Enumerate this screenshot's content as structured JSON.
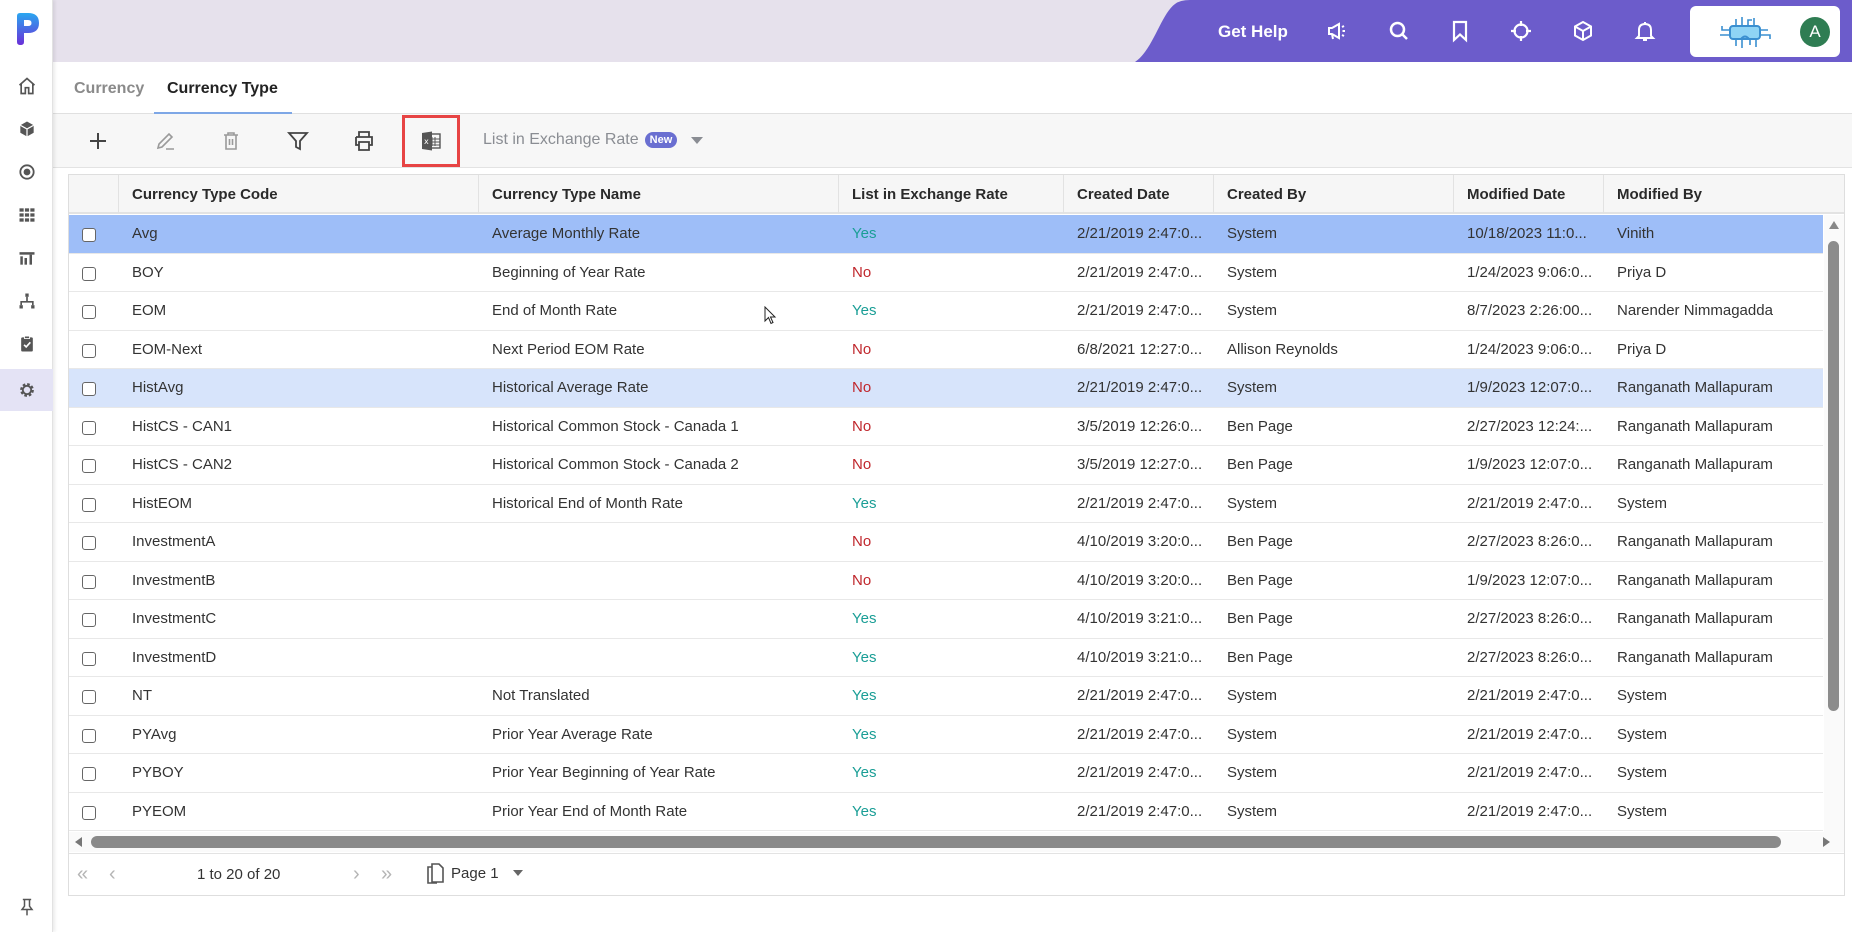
{
  "sidebar": {
    "logo": "P",
    "items": [
      {
        "name": "home",
        "icon": "home-icon"
      },
      {
        "name": "cube",
        "icon": "cube-icon"
      },
      {
        "name": "target",
        "icon": "target-icon"
      },
      {
        "name": "grid",
        "icon": "grid-icon"
      },
      {
        "name": "reports",
        "icon": "bar-chart-icon"
      },
      {
        "name": "hierarchy",
        "icon": "hierarchy-icon"
      },
      {
        "name": "tasks",
        "icon": "clipboard-check-icon"
      },
      {
        "name": "settings",
        "icon": "gear-icon",
        "active": true
      }
    ],
    "pin_icon": "pin-icon"
  },
  "header": {
    "get_help": "Get Help",
    "icons": [
      "megaphone-icon",
      "search-icon",
      "bookmark-icon",
      "crosshair-icon",
      "cube-icon",
      "bell-icon"
    ],
    "avatar_initial": "A",
    "brand_color": "#6c5ccb"
  },
  "tabs": [
    {
      "label": "Currency",
      "active": false
    },
    {
      "label": "Currency Type",
      "active": true
    }
  ],
  "toolbar": {
    "actions": [
      "add",
      "edit",
      "delete",
      "filter",
      "print",
      "export-excel"
    ],
    "list_filter_label": "List in Exchange Rate",
    "new_badge": "New"
  },
  "grid": {
    "columns": [
      "Currency Type Code",
      "Currency Type Name",
      "List in Exchange Rate",
      "Created Date",
      "Created By",
      "Modified Date",
      "Modified By"
    ],
    "rows": [
      {
        "code": "Avg",
        "name": "Average Monthly Rate",
        "list": "Yes",
        "created_date": "2/21/2019 2:47:0...",
        "created_by": "System",
        "modified_date": "10/18/2023 11:0...",
        "modified_by": "Vinith",
        "state": "selected"
      },
      {
        "code": "BOY",
        "name": "Beginning of Year Rate",
        "list": "No",
        "created_date": "2/21/2019 2:47:0...",
        "created_by": "System",
        "modified_date": "1/24/2023 9:06:0...",
        "modified_by": "Priya D",
        "state": ""
      },
      {
        "code": "EOM",
        "name": "End of Month Rate",
        "list": "Yes",
        "created_date": "2/21/2019 2:47:0...",
        "created_by": "System",
        "modified_date": "8/7/2023 2:26:00...",
        "modified_by": "Narender Nimmagadda",
        "state": ""
      },
      {
        "code": "EOM-Next",
        "name": "Next Period EOM Rate",
        "list": "No",
        "created_date": "6/8/2021 12:27:0...",
        "created_by": "Allison Reynolds",
        "modified_date": "1/24/2023 9:06:0...",
        "modified_by": "Priya D",
        "state": ""
      },
      {
        "code": "HistAvg",
        "name": "Historical Average Rate",
        "list": "No",
        "created_date": "2/21/2019 2:47:0...",
        "created_by": "System",
        "modified_date": "1/9/2023 12:07:0...",
        "modified_by": "Ranganath Mallapuram",
        "state": "hover"
      },
      {
        "code": "HistCS - CAN1",
        "name": "Historical Common Stock - Canada 1",
        "list": "No",
        "created_date": "3/5/2019 12:26:0...",
        "created_by": "Ben Page",
        "modified_date": "2/27/2023 12:24:...",
        "modified_by": "Ranganath Mallapuram",
        "state": ""
      },
      {
        "code": "HistCS - CAN2",
        "name": "Historical Common Stock - Canada 2",
        "list": "No",
        "created_date": "3/5/2019 12:27:0...",
        "created_by": "Ben Page",
        "modified_date": "1/9/2023 12:07:0...",
        "modified_by": "Ranganath Mallapuram",
        "state": ""
      },
      {
        "code": "HistEOM",
        "name": "Historical End of Month Rate",
        "list": "Yes",
        "created_date": "2/21/2019 2:47:0...",
        "created_by": "System",
        "modified_date": "2/21/2019 2:47:0...",
        "modified_by": "System",
        "state": ""
      },
      {
        "code": "InvestmentA",
        "name": "",
        "list": "No",
        "created_date": "4/10/2019 3:20:0...",
        "created_by": "Ben Page",
        "modified_date": "2/27/2023 8:26:0...",
        "modified_by": "Ranganath Mallapuram",
        "state": ""
      },
      {
        "code": "InvestmentB",
        "name": "",
        "list": "No",
        "created_date": "4/10/2019 3:20:0...",
        "created_by": "Ben Page",
        "modified_date": "1/9/2023 12:07:0...",
        "modified_by": "Ranganath Mallapuram",
        "state": ""
      },
      {
        "code": "InvestmentC",
        "name": "",
        "list": "Yes",
        "created_date": "4/10/2019 3:21:0...",
        "created_by": "Ben Page",
        "modified_date": "2/27/2023 8:26:0...",
        "modified_by": "Ranganath Mallapuram",
        "state": ""
      },
      {
        "code": "InvestmentD",
        "name": "",
        "list": "Yes",
        "created_date": "4/10/2019 3:21:0...",
        "created_by": "Ben Page",
        "modified_date": "2/27/2023 8:26:0...",
        "modified_by": "Ranganath Mallapuram",
        "state": ""
      },
      {
        "code": "NT",
        "name": "Not Translated",
        "list": "Yes",
        "created_date": "2/21/2019 2:47:0...",
        "created_by": "System",
        "modified_date": "2/21/2019 2:47:0...",
        "modified_by": "System",
        "state": ""
      },
      {
        "code": "PYAvg",
        "name": "Prior Year Average Rate",
        "list": "Yes",
        "created_date": "2/21/2019 2:47:0...",
        "created_by": "System",
        "modified_date": "2/21/2019 2:47:0...",
        "modified_by": "System",
        "state": ""
      },
      {
        "code": "PYBOY",
        "name": "Prior Year Beginning of Year Rate",
        "list": "Yes",
        "created_date": "2/21/2019 2:47:0...",
        "created_by": "System",
        "modified_date": "2/21/2019 2:47:0...",
        "modified_by": "System",
        "state": ""
      },
      {
        "code": "PYEOM",
        "name": "Prior Year End of Month Rate",
        "list": "Yes",
        "created_date": "2/21/2019 2:47:0...",
        "created_by": "System",
        "modified_date": "2/21/2019 2:47:0...",
        "modified_by": "System",
        "state": ""
      }
    ],
    "colors": {
      "yes": "#1a9e96",
      "no": "#c0272d",
      "selected_row": "#9ebef8",
      "hover_row": "#d7e4fb"
    }
  },
  "pager": {
    "info": "1 to 20 of 20",
    "page_label": "Page 1"
  }
}
